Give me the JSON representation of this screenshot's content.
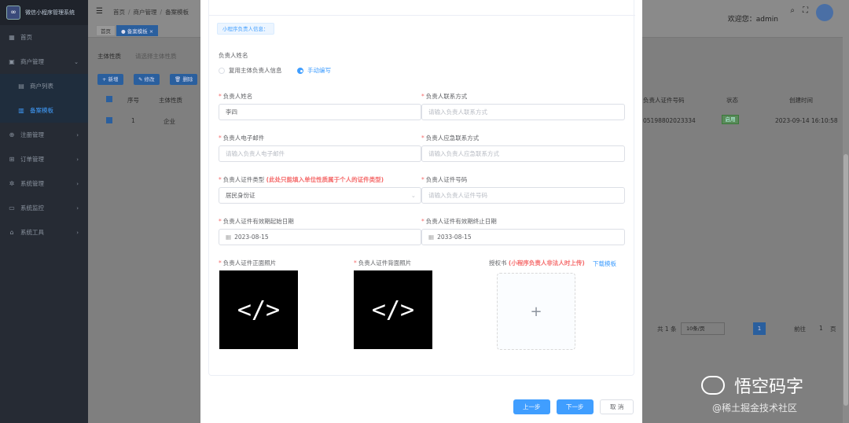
{
  "sidebar": {
    "title": "微信小程序管理系统",
    "items": [
      {
        "label": "首页",
        "icon": "dashboard-icon"
      },
      {
        "label": "商户管理",
        "icon": "shop-icon",
        "arrow": "⌄"
      },
      {
        "label": "商户列表",
        "icon": "list-icon"
      },
      {
        "label": "备案模板",
        "icon": "template-icon"
      },
      {
        "label": "注册管理",
        "icon": "register-icon",
        "arrow": "›"
      },
      {
        "label": "订单管理",
        "icon": "cart-icon",
        "arrow": "›"
      },
      {
        "label": "系统管理",
        "icon": "gear-icon",
        "arrow": "›"
      },
      {
        "label": "系统监控",
        "icon": "monitor-icon",
        "arrow": "›"
      },
      {
        "label": "系统工具",
        "icon": "tool-icon",
        "arrow": "›"
      }
    ]
  },
  "header": {
    "breadcrumb": [
      "首页",
      "商户管理",
      "备案模板"
    ],
    "welcome": "欢迎您：admin"
  },
  "tags": {
    "home": "首页",
    "active": "● 备案模板 ×"
  },
  "background": {
    "filter_label": "主体性质",
    "filter_placeholder": "请选择主体性质",
    "buttons": [
      "+ 新增",
      "✎ 修改",
      "🗑 删除"
    ],
    "columns": {
      "index": "序号",
      "entity": "主体性质",
      "cert_no": "负责人证件号码",
      "status": "状态",
      "created": "创建时间"
    },
    "row": {
      "index": "1",
      "entity": "企业",
      "cert_no": "05198802023334",
      "status": "启用",
      "created": "2023-09-14 16:10:58"
    },
    "pagination": {
      "total": "共 1 条",
      "page_size": "10条/页",
      "current": "1",
      "goto": "前往",
      "goto_page": "1",
      "unit": "页"
    }
  },
  "dialog": {
    "section_tag": "小程序负责人信息：",
    "name_title": "负责人姓名",
    "radio_reuse": "复用主体负责人信息",
    "radio_manual": "手动编写",
    "fields": {
      "name": {
        "label": "负责人姓名",
        "value": "李四"
      },
      "phone": {
        "label": "负责人联系方式",
        "placeholder": "请输入负责人联系方式"
      },
      "email": {
        "label": "负责人电子邮件",
        "placeholder": "请输入负责人电子邮件"
      },
      "emergency": {
        "label": "负责人应急联系方式",
        "placeholder": "请输入负责人应急联系方式"
      },
      "cert_type": {
        "label": "负责人证件类型",
        "note": "(此处只能填入单位性质属于个人的证件类型)",
        "value": "居民身份证"
      },
      "cert_no": {
        "label": "负责人证件号码",
        "placeholder": "请输入负责人证件号码"
      },
      "valid_start": {
        "label": "负责人证件有效期起始日期",
        "value": "2023-08-15"
      },
      "valid_end": {
        "label": "负责人证件有效期终止日期",
        "value": "2033-08-15"
      },
      "photo_front": {
        "label": "负责人证件正面照片"
      },
      "photo_back": {
        "label": "负责人证件背面照片"
      },
      "auth_letter": {
        "label": "授权书",
        "note": "(小程序负责人非法人时上传)",
        "link": "下载模板"
      }
    },
    "code_glyph": "</>",
    "upload_plus": "+",
    "buttons": {
      "prev": "上一步",
      "next": "下一步",
      "cancel": "取 消"
    }
  },
  "watermark": {
    "brand": "悟空码字",
    "community": "@稀土掘金技术社区"
  }
}
